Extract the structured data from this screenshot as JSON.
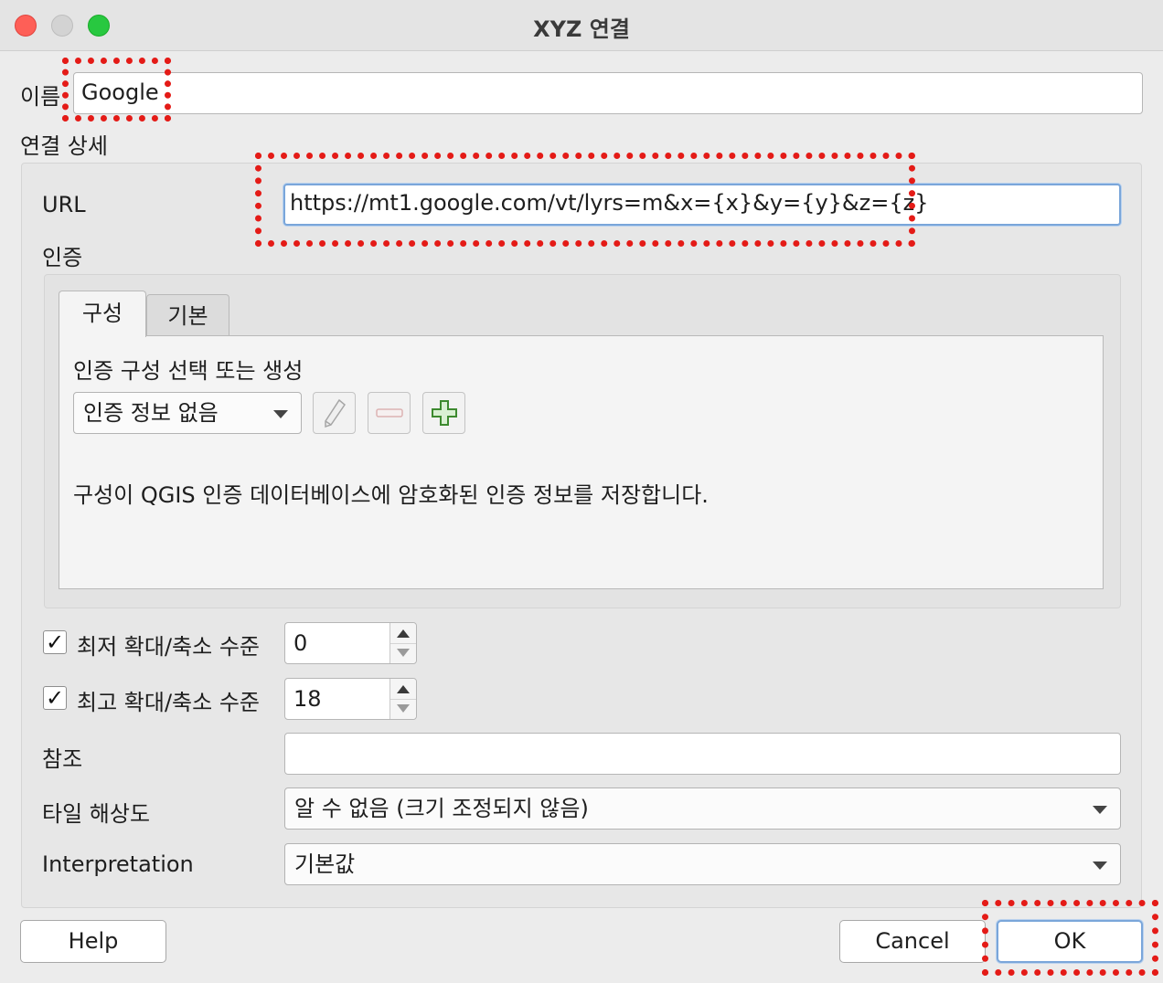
{
  "window": {
    "title": "XYZ 연결"
  },
  "name": {
    "label": "이름",
    "value": "Google"
  },
  "details": {
    "title": "연결 상세",
    "url_label": "URL",
    "url_value": "https://mt1.google.com/vt/lyrs=m&x={x}&y={y}&z={z}",
    "auth_label": "인증",
    "tabs": [
      {
        "label": "구성"
      },
      {
        "label": "기본"
      }
    ],
    "auth_config_title": "인증 구성 선택 또는 생성",
    "auth_select_value": "인증 정보 없음",
    "auth_info_text": "구성이 QGIS 인증 데이터베이스에 암호화된 인증 정보를 저장합니다.",
    "min_zoom": {
      "label": "최저 확대/축소 수준",
      "checked": true,
      "value": "0"
    },
    "max_zoom": {
      "label": "최고 확대/축소 수준",
      "checked": true,
      "value": "18"
    },
    "referer": {
      "label": "참조",
      "value": ""
    },
    "tile_resolution": {
      "label": "타일 해상도",
      "value": "알 수 없음 (크기 조정되지 않음)"
    },
    "interpretation": {
      "label": "Interpretation",
      "value": "기본값"
    }
  },
  "buttons": {
    "help": "Help",
    "cancel": "Cancel",
    "ok": "OK"
  },
  "check_mark": "✓",
  "colors": {
    "highlight": "#e41b17",
    "focus": "#7aa6da"
  }
}
